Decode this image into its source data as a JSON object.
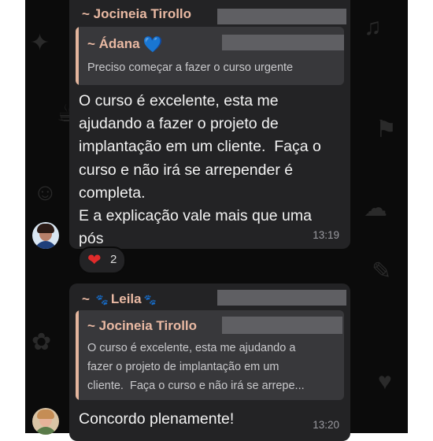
{
  "messages": [
    {
      "sender": "~ Jocineia Tirollo",
      "quote": {
        "author": "~ Ádana",
        "author_emoji": "blue-heart-icon",
        "text": "Preciso começar a fazer o curso urgente"
      },
      "body": [
        "O curso é excelente, esta me",
        "ajudando a fazer o projeto de",
        "implantação em um cliente.  Faça o",
        "curso e não irá se arrepender é",
        "completa.",
        "E a explicação vale mais que uma",
        "pós"
      ],
      "time": "13:19",
      "reaction": {
        "emoji": "red-heart-icon",
        "count": "2"
      }
    },
    {
      "sender_prefix": "~",
      "sender_name": "Leila",
      "quote": {
        "author": "~ Jocineia Tirollo",
        "lines": [
          "O curso é excelente, esta me ajudando a",
          "fazer o projeto de implantação em um",
          "cliente.  Faça o curso e não irá se arrepe..."
        ]
      },
      "body": "Concordo plenamente!",
      "time": "13:20"
    }
  ],
  "colors": {
    "background": "#0b0b0b",
    "bubble": "#232325",
    "quote_bg": "#38383b",
    "quote_bar": "#e3b59d",
    "sender": "#e9b9a3",
    "text": "#f2f2f2",
    "meta": "#9a9aa0"
  }
}
